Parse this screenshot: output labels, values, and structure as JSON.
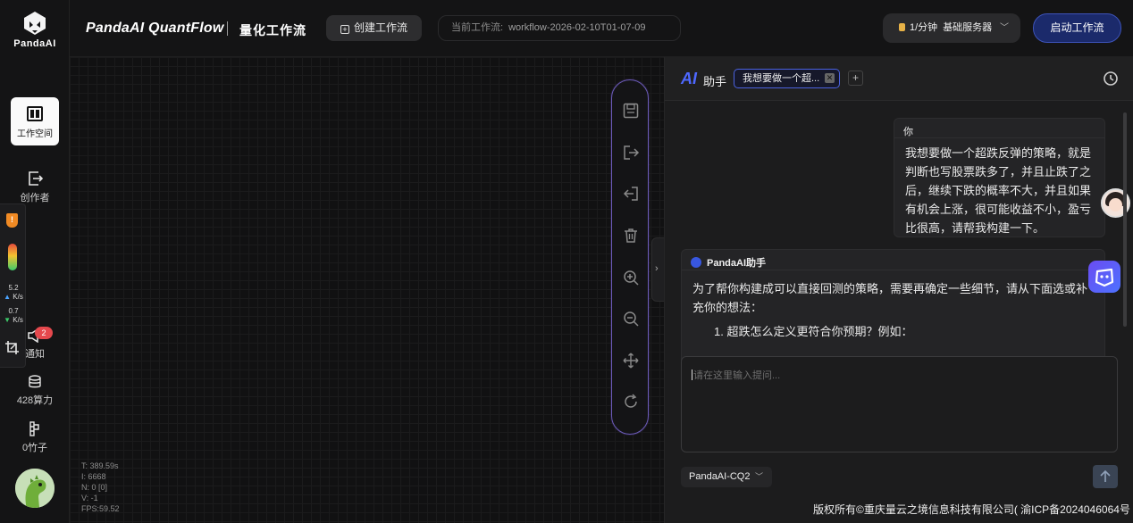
{
  "brand": {
    "logo_text": "PandaAI",
    "app_title": "PandaAI QuantFlow",
    "section_title": "量化工作流"
  },
  "header": {
    "create_button": "创建工作流",
    "current_workflow_label": "当前工作流:",
    "current_workflow_value": "workflow-2026-02-10T01-07-09",
    "server_rate": "1/分钟",
    "server_name": "基础服务器",
    "start_button": "启动工作流"
  },
  "sidebar": {
    "items": [
      {
        "label": "工作空间",
        "icon": "workspace-icon",
        "active": true
      },
      {
        "label": "创作者",
        "icon": "creator-icon"
      },
      {
        "label": "通知",
        "icon": "notification-icon",
        "badge": "2"
      },
      {
        "label": "428算力",
        "icon": "compute-icon"
      },
      {
        "label": "0竹子",
        "icon": "bamboo-icon"
      }
    ]
  },
  "perf_overlay": {
    "shield_label": "!",
    "upload_value": "5.2",
    "upload_unit": "K/s",
    "download_value": "0.7",
    "download_unit": "K/s"
  },
  "canvas_stats": [
    "T: 389.59s",
    "I: 6668",
    "N: 0 [0]",
    "V: -1",
    "FPS:59.52"
  ],
  "toolbar_icons": [
    "save-icon",
    "export-icon",
    "import-icon",
    "delete-icon",
    "zoom-in-icon",
    "zoom-out-icon",
    "move-icon",
    "refresh-icon"
  ],
  "assistant": {
    "logo": "AI",
    "title": "助手",
    "active_tab": "我想要做一个超...",
    "add_tab": "+",
    "user_name": "你",
    "user_message": "我想要做一个超跌反弹的策略，就是判断也写股票跌多了，并且止跌了之后，继续下跌的概率不大，并且如果有机会上涨，很可能收益不小，盈亏比很高，请帮我构建一下。",
    "ai_name": "PandaAI助手",
    "ai_message": "为了帮你构建成可以直接回测的策略，需要再确定一些细节，请从下面选或补充你的想法：",
    "ai_list_item": "1. 超跌怎么定义更符合你预期？例如：",
    "input_placeholder": "请在这里输入提问...",
    "model": "PandaAI-CQ2"
  },
  "footer": {
    "copyright": "版权所有©重庆量云之境信息科技有限公司( 渝ICP备2024046064号 )"
  },
  "colors": {
    "accent": "#3d53b8",
    "toolbar_border": "#6b5bb8",
    "badge": "#e5484d"
  }
}
